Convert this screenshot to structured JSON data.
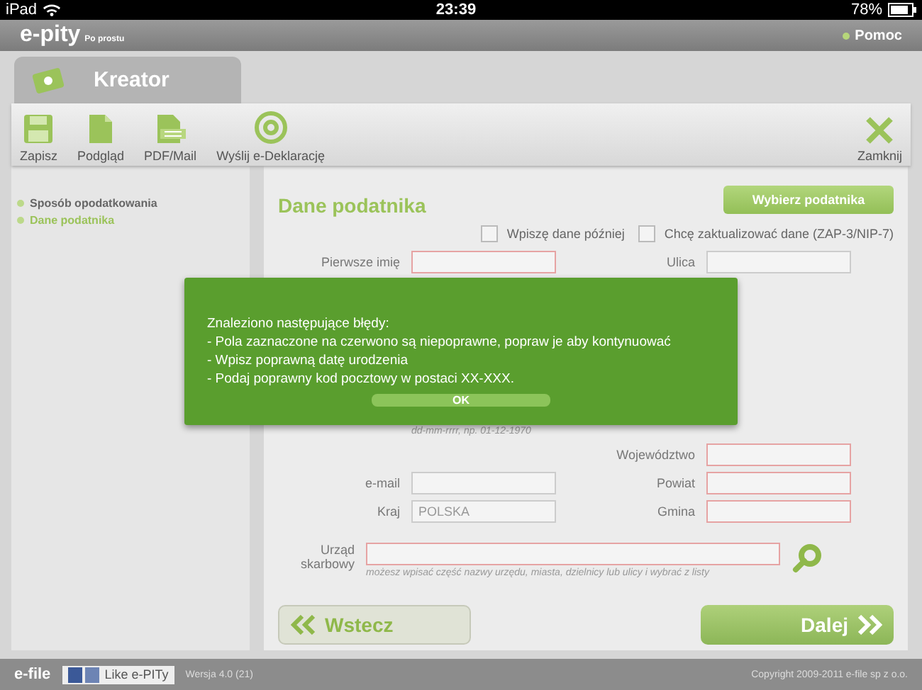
{
  "status_bar": {
    "device": "iPad",
    "time": "23:39",
    "battery": "78%"
  },
  "header": {
    "logo": "e-pity",
    "tagline": "Po prostu",
    "help": "Pomoc"
  },
  "wizard_tab": {
    "title": "Kreator"
  },
  "toolbar": {
    "items": [
      {
        "kind": "save",
        "label": "Zapisz"
      },
      {
        "kind": "preview",
        "label": "Podgląd"
      },
      {
        "kind": "pdf",
        "label": "PDF/Mail"
      },
      {
        "kind": "send",
        "label": "Wyślij e-Deklarację"
      }
    ],
    "close": {
      "label": "Zamknij"
    }
  },
  "sidebar": {
    "items": [
      {
        "label": "Sposób opodatkowania",
        "selected": false
      },
      {
        "label": "Dane podatnika",
        "selected": true
      }
    ]
  },
  "form": {
    "title": "Dane podatnika",
    "choose_button": "Wybierz podatnika",
    "checkboxes": [
      {
        "label": "Wpiszę dane później",
        "checked": false
      },
      {
        "label": "Chcę zaktualizować dane (ZAP-3/NIP-7)",
        "checked": false
      }
    ],
    "top_row": {
      "left": {
        "label": "Pierwsze imię",
        "error": true
      },
      "right": {
        "label": "Ulica",
        "error": false
      }
    },
    "date_hint": "dd-mm-rrrr, np. 01-12-1970",
    "rows": [
      {
        "left": null,
        "right": {
          "label": "Województwo",
          "error": true
        }
      },
      {
        "left": {
          "label": "e-mail",
          "error": false
        },
        "right": {
          "label": "Powiat",
          "error": true
        }
      },
      {
        "left": {
          "label": "Kraj",
          "error": false,
          "value": "POLSKA"
        },
        "right": {
          "label": "Gmina",
          "error": true
        }
      }
    ],
    "tax_office": {
      "label": "Urząd skarbowy",
      "error": true,
      "hint": "możesz wpisać część nazwy urzędu, miasta, dzielnicy lub ulicy i wybrać z listy"
    }
  },
  "nav": {
    "back": "Wstecz",
    "next": "Dalej"
  },
  "dialog": {
    "lines": [
      "Znaleziono następujące błędy:",
      "- Pola zaznaczone na czerwono są niepoprawne, popraw je aby kontynuować",
      "- Wpisz poprawną datę urodzenia",
      "- Podaj poprawny kod pocztowy w postaci XX-XXX."
    ],
    "button": "OK"
  },
  "footer": {
    "brand": "e-file",
    "like": "Like e-PITy",
    "version": "Wersja 4.0 (21)",
    "copyright": "Copyright 2009-2011 e-file sp z o.o."
  }
}
